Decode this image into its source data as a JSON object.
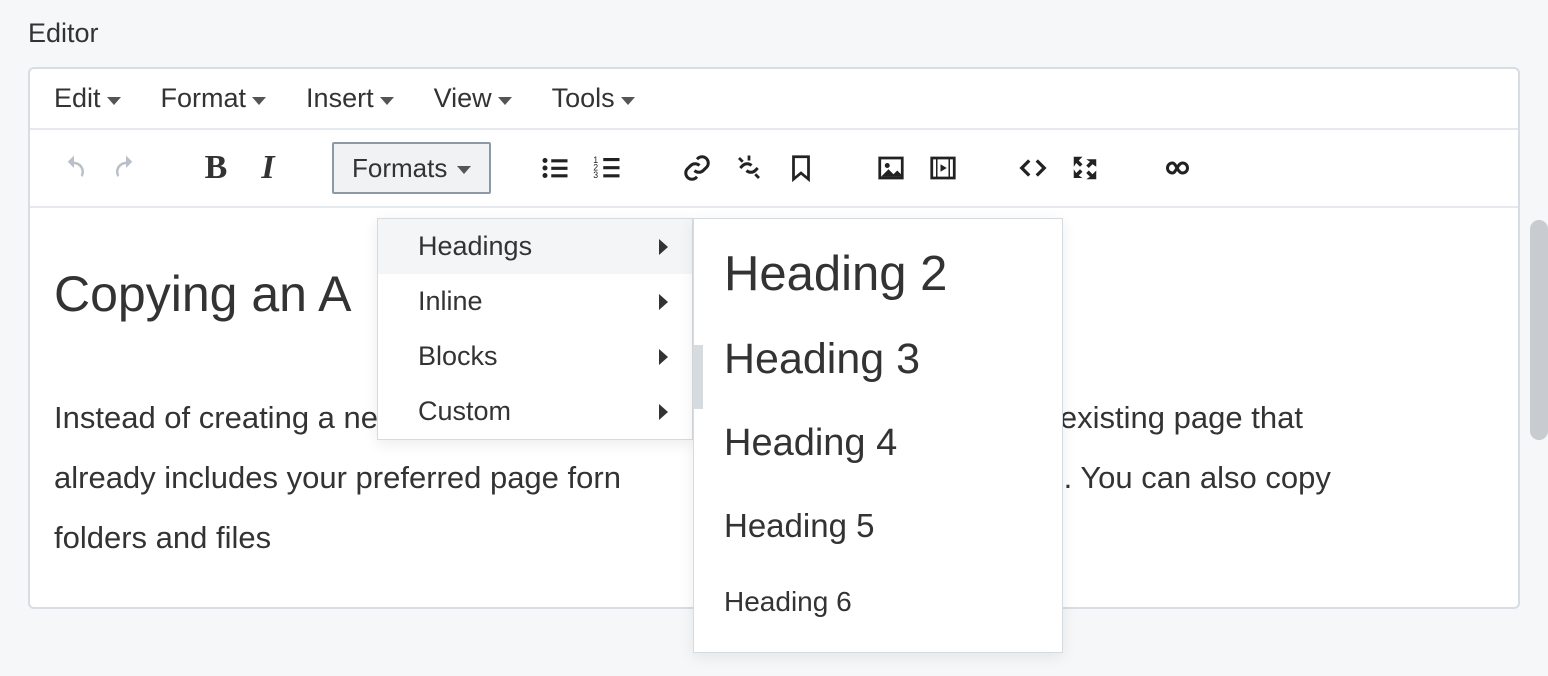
{
  "editor_label": "Editor",
  "menubar": {
    "edit": "Edit",
    "format": "Format",
    "insert": "Insert",
    "view": "View",
    "tools": "Tools"
  },
  "toolbar": {
    "formats_label": "Formats",
    "bold_glyph": "B",
    "italic_glyph": "I"
  },
  "formats_menu": {
    "headings": "Headings",
    "inline": "Inline",
    "blocks": "Blocks",
    "custom": "Custom"
  },
  "headings_menu": {
    "h2": "Heading 2",
    "h3": "Heading 3",
    "h4": "Heading 4",
    "h5": "Heading 5",
    "h6": "Heading 6"
  },
  "document": {
    "title": "Copying an A",
    "body_line1": "Instead of creating a new page, you may",
    "body_line1_right": "f an existing page that",
    "body_line2": "already includes your preferred page forn",
    "body_line2_right": "ypes. You can also copy",
    "body_line3": "folders and files"
  }
}
